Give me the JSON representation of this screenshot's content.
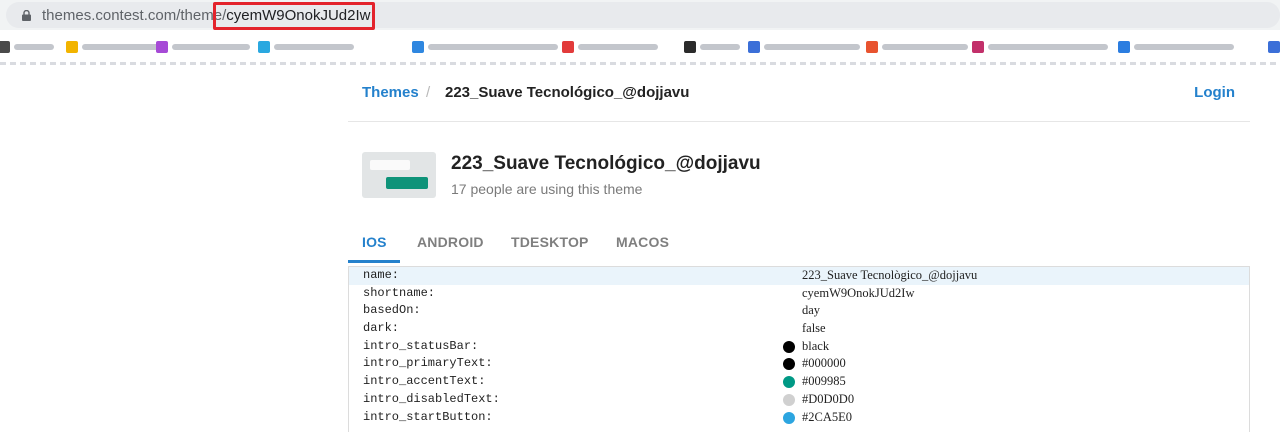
{
  "browser": {
    "url_host": "themes.contest.com/theme/",
    "url_path": "cyemW9OnokJUd2Iw"
  },
  "bookmarks": [
    {
      "color": "#4a4a4a"
    },
    {
      "color": "#f2b400"
    },
    {
      "color": "#a64ad6"
    },
    {
      "color": "#2aa8e0"
    },
    {
      "color": "#2f87e0"
    },
    {
      "color": "#e23b3b"
    },
    {
      "color": "#2b2b2b"
    },
    {
      "color": "#3b6fd8"
    },
    {
      "color": "#e8532f"
    },
    {
      "color": "#c2306a"
    },
    {
      "color": "#2b7de0"
    },
    {
      "color": "#3b6fd8"
    }
  ],
  "header": {
    "breadcrumb_root": "Themes",
    "breadcrumb_sep": "/",
    "breadcrumb_current": "223_Suave Tecnológico_@dojjavu",
    "login": "Login"
  },
  "theme": {
    "title": "223_Suave Tecnológico_@dojjavu",
    "users": "17 people are using this theme"
  },
  "tabs": [
    {
      "label": "IOS",
      "active": true
    },
    {
      "label": "ANDROID",
      "active": false
    },
    {
      "label": "TDESKTOP",
      "active": false
    },
    {
      "label": "MACOS",
      "active": false
    }
  ],
  "properties": [
    {
      "key": "name:",
      "value": "223_Suave Tecnològico_@dojjavu",
      "swatch": null
    },
    {
      "key": "shortname:",
      "value": "cyemW9OnokJUd2Iw",
      "swatch": null
    },
    {
      "key": "basedOn:",
      "value": "day",
      "swatch": null
    },
    {
      "key": "dark:",
      "value": "false",
      "swatch": null
    },
    {
      "key": "intro_statusBar:",
      "value": "black",
      "swatch": "#000000"
    },
    {
      "key": "intro_primaryText:",
      "value": "#000000",
      "swatch": "#000000"
    },
    {
      "key": "intro_accentText:",
      "value": "#009985",
      "swatch": "#009985"
    },
    {
      "key": "intro_disabledText:",
      "value": "#D0D0D0",
      "swatch": "#D0D0D0"
    },
    {
      "key": "intro_startButton:",
      "value": "#2CA5E0",
      "swatch": "#2CA5E0"
    }
  ],
  "colors": {
    "accent": "#2481cc",
    "highlight_row": "#eaf4fb"
  }
}
